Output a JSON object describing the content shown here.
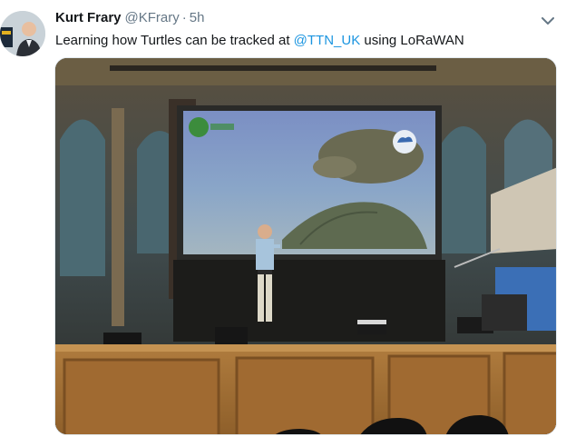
{
  "tweet": {
    "author_name": "Kurt Frary",
    "author_handle": "@KFrary",
    "separator": "·",
    "time": "5h",
    "text_before": "Learning how Turtles can be tracked at ",
    "mention": "@TTN_UK",
    "text_after": " using LoRaWAN",
    "menu_icon": "chevron-down-icon"
  },
  "colors": {
    "accent": "#1b95e0",
    "secondary_text": "#657786",
    "primary_text": "#14171a"
  }
}
